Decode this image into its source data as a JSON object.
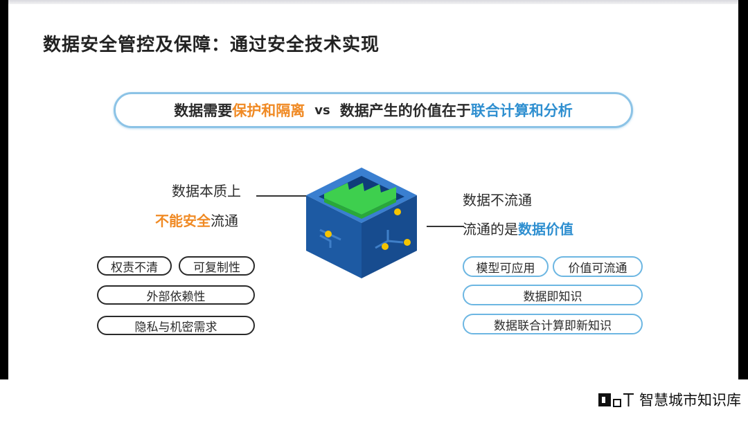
{
  "slide": {
    "title": "数据安全管控及保障：通过安全技术实现",
    "banner": {
      "part1": "数据需要",
      "part2": "保护和隔离",
      "vs": "vs",
      "part3": "数据产生的价值在于",
      "part4": "联合计算和分析"
    },
    "left": {
      "line1": "数据本质上",
      "line2_highlight": "不能安全",
      "line2_rest": "流通",
      "pills": [
        "权责不清",
        "可复制性",
        "外部依赖性",
        "隐私与机密需求"
      ]
    },
    "right": {
      "line1": "数据不流通",
      "line2_rest": "流通的是",
      "line2_highlight": "数据价值",
      "pills": [
        "模型可应用",
        "价值可流通",
        "数据即知识",
        "数据联合计算即新知识"
      ]
    },
    "colors": {
      "orange": "#f08a24",
      "blue": "#2f8fd0",
      "cube": "#1f5fa8",
      "green": "#3ecf4e",
      "dot": "#f5c400"
    }
  },
  "watermark": {
    "text": "智慧城市知识库",
    "icon": "logo-icon"
  }
}
